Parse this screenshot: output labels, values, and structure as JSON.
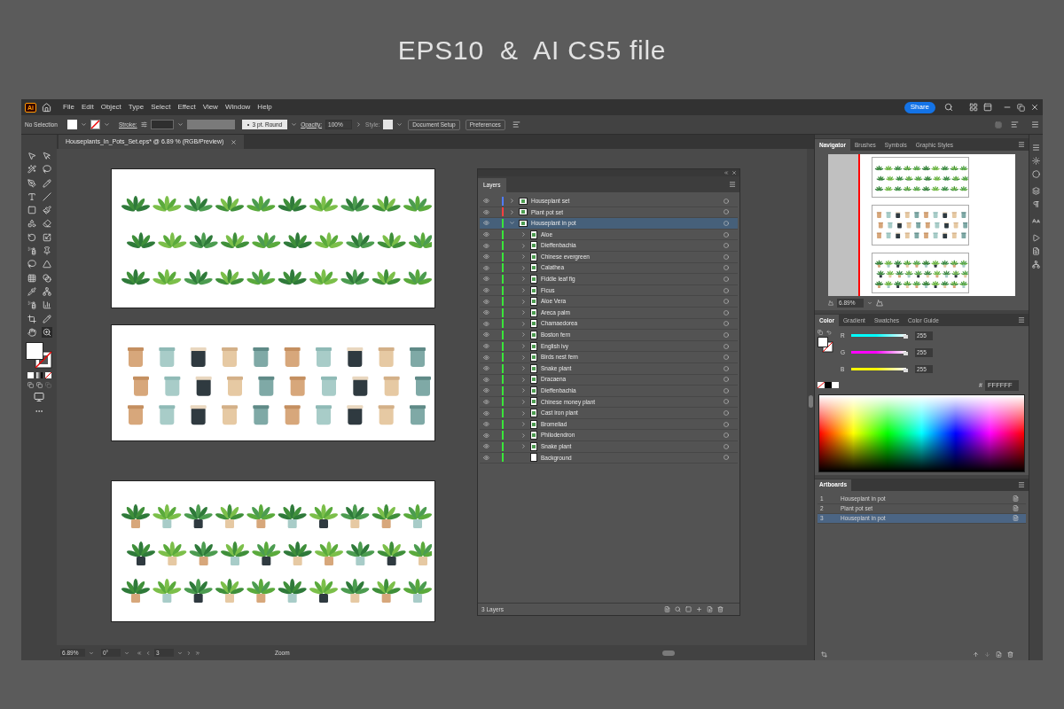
{
  "heading": "EPS10  &  AI CS5 file",
  "app_logo": "Ai",
  "menu": [
    "File",
    "Edit",
    "Object",
    "Type",
    "Select",
    "Effect",
    "View",
    "Window",
    "Help"
  ],
  "share": "Share",
  "control_bar": {
    "selection": "No Selection",
    "stroke_label": "Stroke:",
    "brush": "3 pt. Round",
    "opacity_label": "Opacity:",
    "opacity": "100%",
    "style_label": "Style:",
    "buttons": [
      "Document Setup",
      "Preferences"
    ]
  },
  "document_tab": "Houseplants_In_Pots_Set.eps* @ 6.89 % (RGB/Preview)",
  "artboards": [
    {
      "kind": "plants"
    },
    {
      "kind": "pots"
    },
    {
      "kind": "potted"
    }
  ],
  "layers": {
    "title": "Layers",
    "footer": "3 Layers",
    "items": [
      {
        "name": "Houseplant set",
        "color": "#4f7cff",
        "expanded": false,
        "selected": false
      },
      {
        "name": "Plant pot set",
        "color": "#ff4040",
        "expanded": false,
        "selected": false
      },
      {
        "name": "Houseplant in pot",
        "color": "#39e639",
        "expanded": true,
        "selected": true,
        "children": [
          {
            "name": "Aloe",
            "expandable": true
          },
          {
            "name": "Dieffenbachia",
            "expandable": true
          },
          {
            "name": "Chinese evergreen",
            "expandable": true
          },
          {
            "name": "Calathea",
            "expandable": true
          },
          {
            "name": "Fiddle leaf fig",
            "expandable": true
          },
          {
            "name": "Ficus",
            "expandable": true
          },
          {
            "name": "Aloe Vera",
            "expandable": true
          },
          {
            "name": "Areca palm",
            "expandable": true
          },
          {
            "name": "Chamaedorea",
            "expandable": true
          },
          {
            "name": "Boston fern",
            "expandable": true
          },
          {
            "name": "English ivy",
            "expandable": true
          },
          {
            "name": "Birds nest fern",
            "expandable": true
          },
          {
            "name": "Snake plant",
            "expandable": true
          },
          {
            "name": "Dracaena",
            "expandable": true
          },
          {
            "name": "Dieffenbachia",
            "expandable": true
          },
          {
            "name": "Chinese money plant",
            "expandable": true
          },
          {
            "name": "Cast iron plant",
            "expandable": true
          },
          {
            "name": "Bromeliad",
            "expandable": true
          },
          {
            "name": "Philodendron",
            "expandable": true
          },
          {
            "name": "Snake plant",
            "expandable": true
          },
          {
            "name": "Background",
            "expandable": false
          }
        ]
      }
    ]
  },
  "navigator": {
    "tabs": [
      {
        "label": "Navigator",
        "selected": true
      },
      {
        "label": "Brushes",
        "selected": false
      },
      {
        "label": "Symbols",
        "selected": false
      },
      {
        "label": "Graphic Styles",
        "selected": false
      }
    ],
    "zoom": "6.89%"
  },
  "color_panel": {
    "tabs": [
      {
        "label": "Color",
        "selected": true
      },
      {
        "label": "Gradient",
        "selected": false
      },
      {
        "label": "Swatches",
        "selected": false
      },
      {
        "label": "Color Guide",
        "selected": false
      }
    ],
    "channels": [
      {
        "name": "R",
        "value": "255",
        "level": 1,
        "color": "#00ffff"
      },
      {
        "name": "G",
        "value": "255",
        "level": 1,
        "color": "#ff00ff"
      },
      {
        "name": "B",
        "value": "255",
        "level": 1,
        "color": "#ffff00"
      }
    ],
    "hex_label": "#",
    "hex": "FFFFFF"
  },
  "artboards_panel": {
    "title": "Artboards",
    "items": [
      {
        "number": "1",
        "name": "Houseplant in pot",
        "selected": false
      },
      {
        "number": "2",
        "name": "Plant pot set",
        "selected": false
      },
      {
        "number": "3",
        "name": "Houseplant in pot",
        "selected": true
      }
    ]
  },
  "status_bar": {
    "zoom": "6.89%",
    "rotation": "0°",
    "artboard": "3",
    "tool": "Zoom"
  }
}
